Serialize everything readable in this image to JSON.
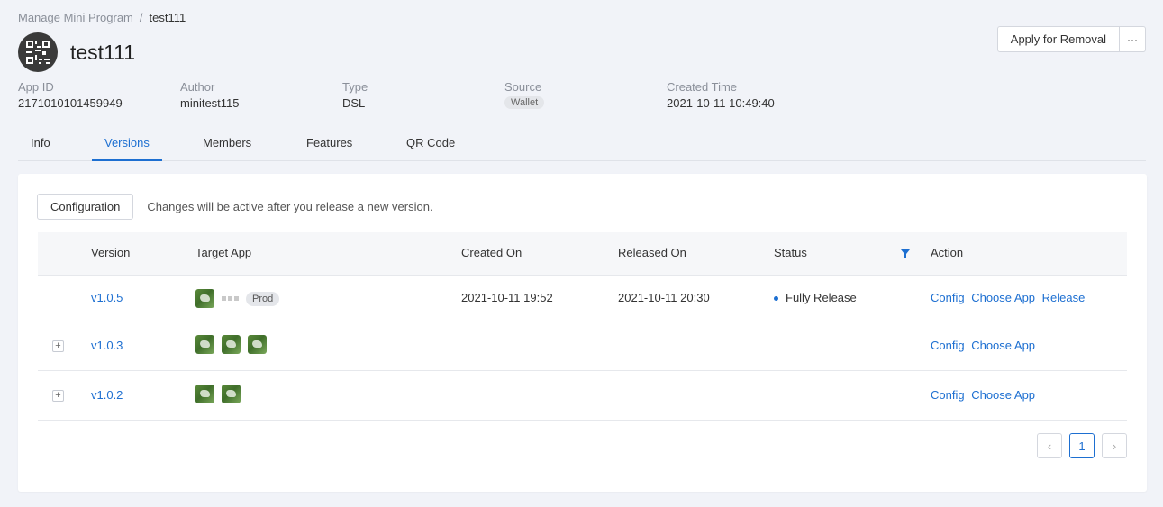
{
  "breadcrumb": {
    "parent": "Manage Mini Program",
    "separator": "/",
    "current": "test111"
  },
  "app": {
    "name": "test111"
  },
  "actions": {
    "apply_removal": "Apply for Removal",
    "more": "···"
  },
  "meta": {
    "app_id": {
      "label": "App ID",
      "value": "2171010101459949"
    },
    "author": {
      "label": "Author",
      "value": "minitest115"
    },
    "type": {
      "label": "Type",
      "value": "DSL"
    },
    "source": {
      "label": "Source",
      "value": "Wallet"
    },
    "created": {
      "label": "Created Time",
      "value": "2021-10-11 10:49:40"
    }
  },
  "tabs": [
    {
      "label": "Info",
      "active": false
    },
    {
      "label": "Versions",
      "active": true
    },
    {
      "label": "Members",
      "active": false
    },
    {
      "label": "Features",
      "active": false
    },
    {
      "label": "QR Code",
      "active": false
    }
  ],
  "config": {
    "button": "Configuration",
    "hint": "Changes will be active after you release a new version."
  },
  "table": {
    "headers": {
      "version": "Version",
      "target_app": "Target App",
      "created_on": "Created On",
      "released_on": "Released On",
      "status": "Status",
      "action": "Action"
    },
    "rows": [
      {
        "version": "v1.0.5",
        "tag": "Prod",
        "created_on": "2021-10-11 19:52",
        "released_on": "2021-10-11 20:30",
        "status": "Fully Release",
        "actions": [
          "Config",
          "Choose App",
          "Release"
        ],
        "expandable": false
      },
      {
        "version": "v1.0.3",
        "actions": [
          "Config",
          "Choose App"
        ],
        "expandable": true,
        "expand_symbol": "+"
      },
      {
        "version": "v1.0.2",
        "actions": [
          "Config",
          "Choose App"
        ],
        "expandable": true,
        "expand_symbol": "+"
      }
    ]
  },
  "pagination": {
    "prev": "‹",
    "current": "1",
    "next": "›"
  },
  "colors": {
    "accent": "#1d6fd1",
    "background": "#f1f3f8"
  }
}
